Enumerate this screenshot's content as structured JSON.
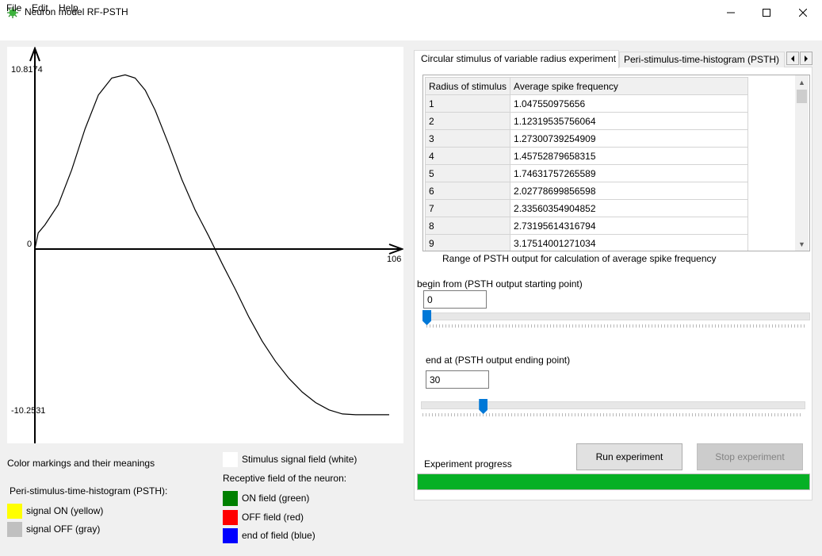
{
  "window": {
    "title": "Neuron model RF-PSTH"
  },
  "menu": [
    "File",
    "Edit",
    "Help"
  ],
  "plot": {
    "y_max_label": "10.8174",
    "y_zero_label": "0",
    "y_min_label": "-10.2531",
    "x_max_label": "106"
  },
  "chart_data": {
    "type": "line",
    "ylim": [
      -10.2531,
      10.8174
    ],
    "xlim": [
      0,
      106
    ],
    "series": [
      {
        "x": [
          0,
          1,
          3,
          7,
          11,
          15,
          19,
          23,
          27,
          30,
          33,
          36,
          40,
          44,
          48,
          52,
          56,
          60,
          64,
          68,
          72,
          76,
          80,
          84,
          88,
          92,
          96,
          100,
          106
        ],
        "values": [
          0,
          1.0,
          1.5,
          2.75,
          4.9,
          7.45,
          9.55,
          10.6,
          10.8,
          10.6,
          9.85,
          8.6,
          6.5,
          4.3,
          2.4,
          0.8,
          -0.9,
          -2.5,
          -4.2,
          -5.7,
          -6.95,
          -8.0,
          -8.85,
          -9.5,
          -9.95,
          -10.2,
          -10.25,
          -10.25,
          -10.25
        ]
      }
    ]
  },
  "tabs": [
    {
      "label": "Circular stimulus of variable radius experiment"
    },
    {
      "label": "Peri-stimulus-time-histogram (PSTH)"
    }
  ],
  "grid": {
    "columns": [
      "Radius of stimulus",
      "Average spike frequency"
    ],
    "rows": [
      [
        "1",
        "1.047550975656"
      ],
      [
        "2",
        "1.12319535756064"
      ],
      [
        "3",
        "1.27300739254909"
      ],
      [
        "4",
        "1.45752879658315"
      ],
      [
        "5",
        "1.74631757265589"
      ],
      [
        "6",
        "2.02778699856598"
      ],
      [
        "7",
        "2.33560354904852"
      ],
      [
        "8",
        "2.73195614316794"
      ],
      [
        "9",
        "3.17514001271034"
      ]
    ]
  },
  "range": {
    "label": "Range of PSTH output for calculation of average spike frequency",
    "begin_label": "begin from (PSTH output starting point)",
    "begin_value": "0",
    "end_label": "end at (PSTH output ending point)",
    "end_value": "30"
  },
  "sliders": {
    "begin_fraction": 0.0,
    "end_fraction": 0.15
  },
  "experiment": {
    "progress_label": "Experiment progress",
    "run_label": "Run experiment",
    "stop_label": "Stop experiment",
    "progress_percent": 100
  },
  "legend": {
    "title": "Color markings and their meanings",
    "psth_heading": "Peri-stimulus-time-histogram (PSTH):",
    "signal_on": "signal ON (yellow)",
    "signal_off": "signal OFF (gray)",
    "stimulus_field": "Stimulus signal field (white)",
    "rf_heading": "Receptive field of the neuron:",
    "on_field": "ON field (green)",
    "off_field": "OFF field (red)",
    "end_field": "end of field (blue)"
  },
  "colors": {
    "signal_on": "#ffff00",
    "signal_off": "#c0c0c0",
    "stimulus": "#ffffff",
    "on_field": "#008000",
    "off_field": "#ff0000",
    "end_field": "#0000ff",
    "progress": "#06b025",
    "accent": "#0078d7"
  }
}
